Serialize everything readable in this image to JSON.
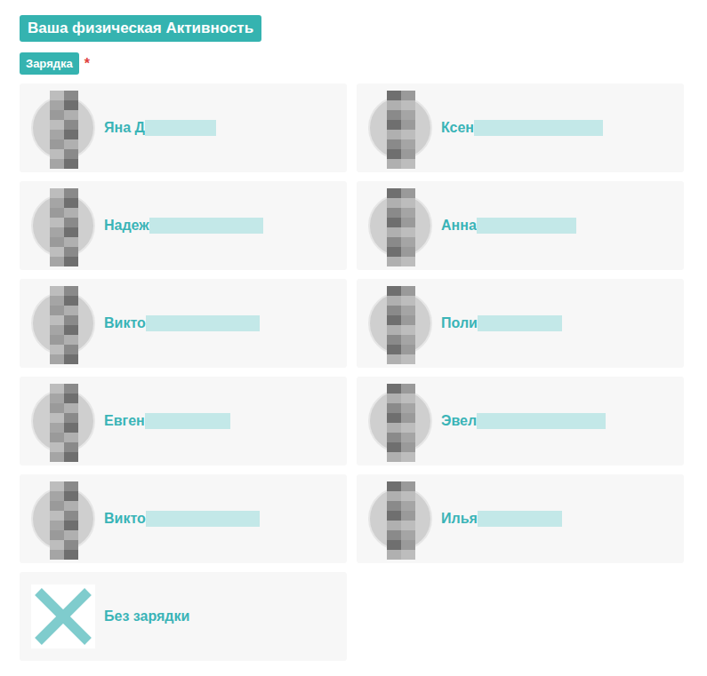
{
  "section": {
    "title": "Ваша физическая Активность"
  },
  "field": {
    "label": "Зарядка",
    "required_mark": "*"
  },
  "options": [
    {
      "name": "Яна Д",
      "kind": "person",
      "selected": false
    },
    {
      "name": "Ксен",
      "kind": "person",
      "selected": false
    },
    {
      "name": "Надеж",
      "kind": "person",
      "selected": false
    },
    {
      "name": "Анна",
      "kind": "person",
      "selected": false
    },
    {
      "name": "Викто",
      "kind": "person",
      "selected": false
    },
    {
      "name": "Поли",
      "kind": "person",
      "selected": false
    },
    {
      "name": "Евген",
      "kind": "person",
      "selected": false
    },
    {
      "name": "Эвел",
      "kind": "person",
      "selected": false
    },
    {
      "name": "Викто",
      "kind": "person",
      "selected": false
    },
    {
      "name": "Илья",
      "kind": "person",
      "selected": false
    },
    {
      "name": "Без зарядки",
      "kind": "none",
      "selected": false
    }
  ]
}
